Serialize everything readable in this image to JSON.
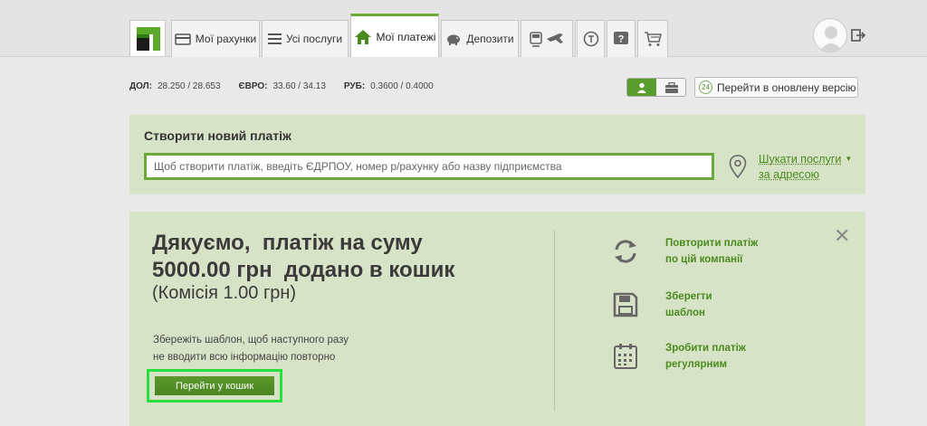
{
  "nav": {
    "tabs": [
      {
        "label": "Мої рахунки",
        "icon": "card-icon"
      },
      {
        "label": "Усі послуги",
        "icon": "list-icon"
      },
      {
        "label": "Мої платежі",
        "icon": "home-icon"
      },
      {
        "label": "Депозити",
        "icon": "piggy-bank-icon"
      }
    ],
    "icon_tabs": [
      "transport-icon",
      "ball-icon",
      "currency-icon",
      "help-icon",
      "cart-icon"
    ]
  },
  "rates": [
    {
      "currency": "ДОЛ:",
      "value": "28.250 / 28.653"
    },
    {
      "currency": "ЄВРО:",
      "value": "33.60 / 34.13"
    },
    {
      "currency": "РУБ:",
      "value": "0.3600 / 0.4000"
    }
  ],
  "new_version": {
    "badge": "24",
    "label": "Перейти в оновлену версію"
  },
  "create": {
    "title": "Створити новий платіж",
    "placeholder": "Щоб створити платіж, введіть ЄДРПОУ, номер р/рахунку або назву підприємства",
    "find_line1": "Шукати послуги",
    "find_line2": "за адресою"
  },
  "success": {
    "line1": "Дякуємо,  платіж на суму",
    "line2": "5000.00 грн  додано в кошик",
    "commission": "(Комісія 1.00 грн)",
    "hint_line1": "Збережіть шаблон, щоб наступного разу",
    "hint_line2": "не вводити всю інформацію повторно",
    "cart_button": "Перейти у кошик",
    "actions": [
      {
        "line1": "Повторити платіж",
        "line2": "по цій компанії",
        "icon": "repeat-icon"
      },
      {
        "line1": "Зберегти",
        "line2": "шаблон",
        "icon": "save-icon"
      },
      {
        "line1": "Зробити платіж",
        "line2": "регулярним",
        "icon": "calendar-icon"
      }
    ]
  },
  "colors": {
    "accent": "#6aa93a",
    "panel": "#d7e3c6",
    "highlight": "#27e03e"
  }
}
